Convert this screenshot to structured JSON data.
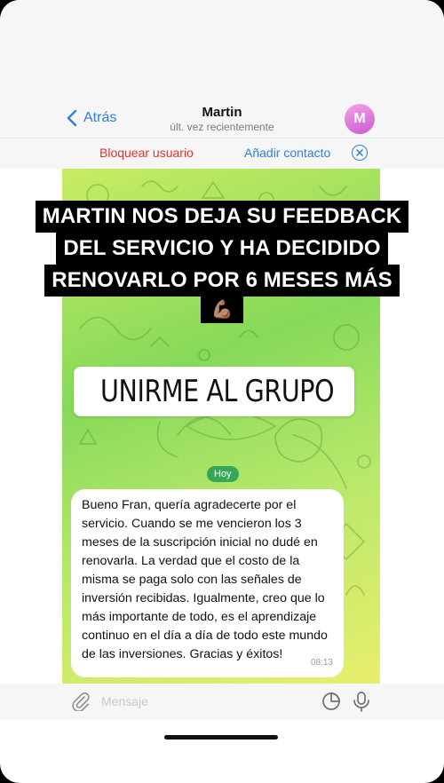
{
  "header": {
    "back_label": "Atrás",
    "contact_name": "Martin",
    "contact_status": "últ. vez recientemente",
    "avatar_initial": "M"
  },
  "actions": {
    "block_label": "Bloquear usuario",
    "add_contact_label": "Añadir contacto"
  },
  "caption": {
    "lines": [
      "MARTIN NOS DEJA SU FEEDBACK",
      "DEL SERVICIO Y HA DECIDIDO",
      "RENOVARLO POR 6 MESES MÁS"
    ],
    "emoji": "💪🏽"
  },
  "join_button": {
    "label": "UNIRME AL GRUPO",
    "icon": "link-icon"
  },
  "chat": {
    "date_label": "Hoy",
    "message": {
      "text": "Bueno Fran, quería agradecerte por el servicio. Cuando se me vencieron los 3 meses de la suscripción inicial no dudé en renovarla. La verdad que el costo de la misma se paga solo con las señales de inversión recibidas. Igualmente, creo que lo más importante de todo, es el aprendizaje continuo en el día a día de todo este mundo de las inversiones. Gracias y éxitos!",
      "time": "08:13"
    }
  },
  "input": {
    "placeholder": "Mensaje"
  },
  "colors": {
    "accent": "#2f7fd8",
    "danger": "#e3312f",
    "date_pill": "#35a858"
  }
}
